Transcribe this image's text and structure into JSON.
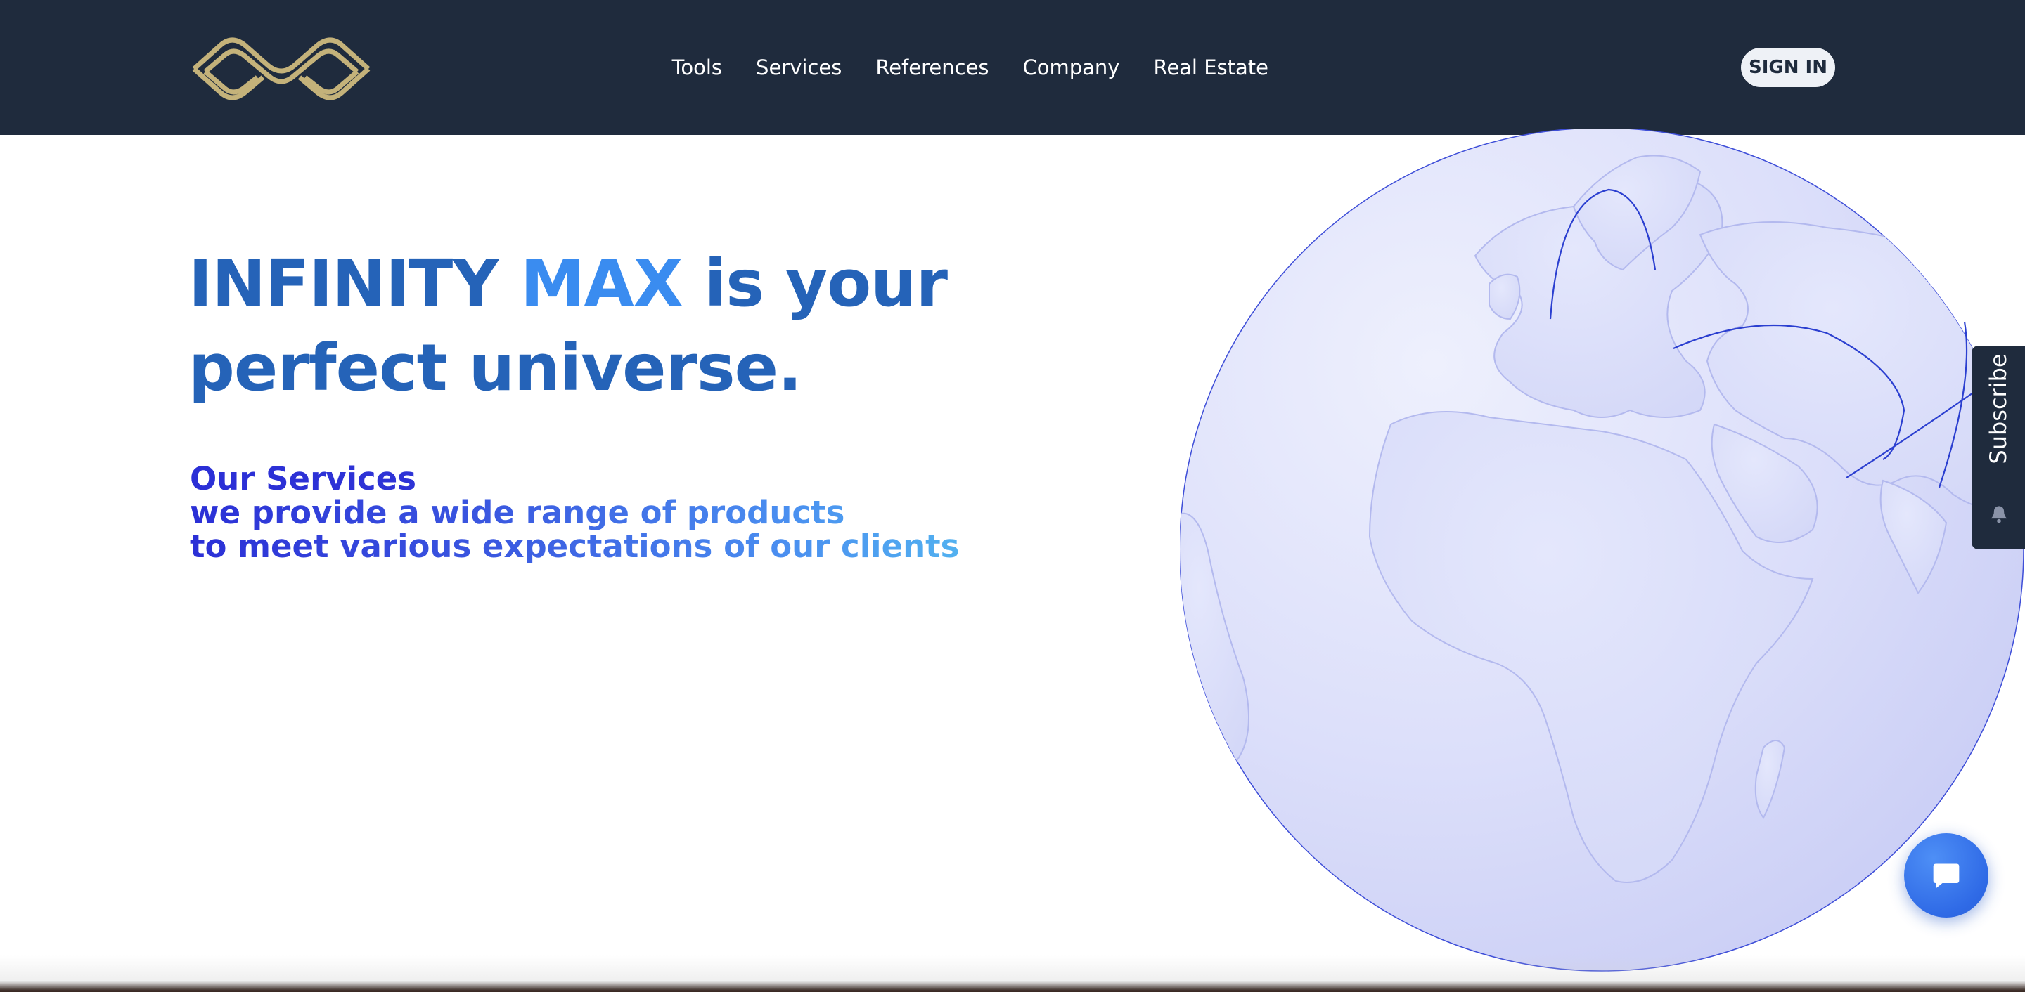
{
  "brand": {
    "logo_icon": "infinity-logo-icon",
    "logo_color": "#c4b27a"
  },
  "nav": {
    "items": [
      {
        "label": "Tools"
      },
      {
        "label": "Services"
      },
      {
        "label": "References"
      },
      {
        "label": "Company"
      },
      {
        "label": "Real Estate"
      }
    ],
    "signin_label": "SIGN IN"
  },
  "hero": {
    "title_part1": "INFINITY",
    "title_accent": "MAX",
    "title_part2": "is your",
    "title_line2": "perfect universe.",
    "services_heading": "Our Services",
    "services_line1": "we provide a wide range of products",
    "services_line2": "to meet various expectations of our clients"
  },
  "subscribe": {
    "label": "Subscribe",
    "icon": "bell-icon"
  },
  "chat": {
    "icon": "chat-bubble-icon"
  },
  "colors": {
    "navbar_bg": "#1f2b3d",
    "title": "#2563b8",
    "title_accent": "#3a8cf0",
    "globe": "#dfe3fb",
    "arc": "#2b3fd0"
  }
}
